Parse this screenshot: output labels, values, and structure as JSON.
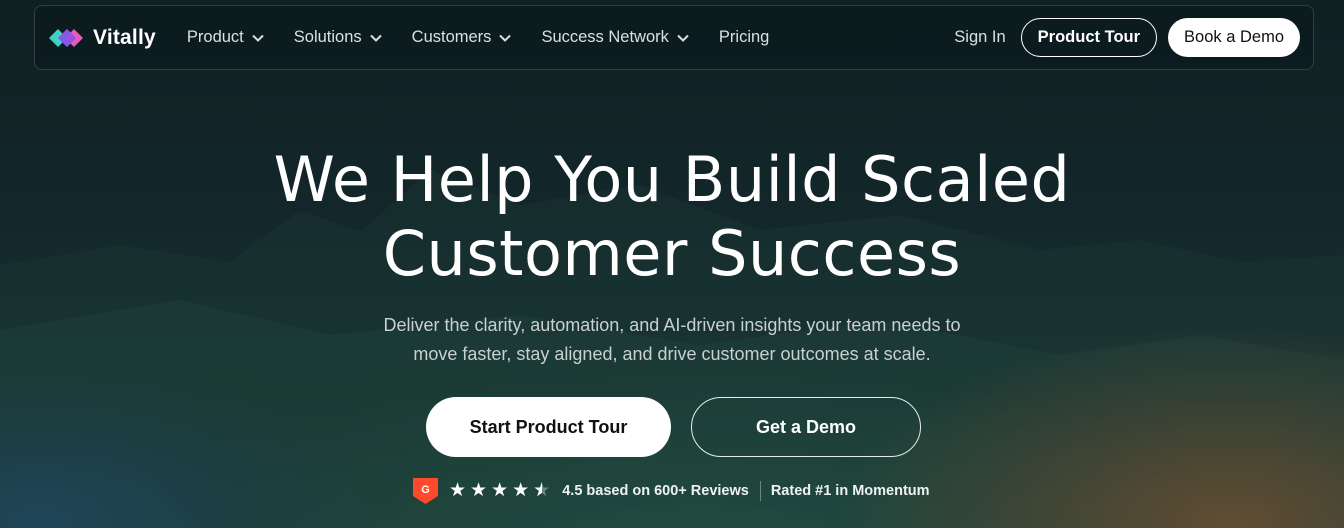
{
  "brand": {
    "name": "Vitally"
  },
  "nav": {
    "items": [
      {
        "label": "Product",
        "has_dropdown": true
      },
      {
        "label": "Solutions",
        "has_dropdown": true
      },
      {
        "label": "Customers",
        "has_dropdown": true
      },
      {
        "label": "Success Network",
        "has_dropdown": true
      },
      {
        "label": "Pricing",
        "has_dropdown": false
      }
    ],
    "sign_in": "Sign In",
    "product_tour": "Product Tour",
    "book_demo": "Book a Demo"
  },
  "hero": {
    "title_line1": "We Help You Build Scaled",
    "title_line2": "Customer Success",
    "subtitle_line1": "Deliver the clarity, automation, and AI-driven insights your team needs to",
    "subtitle_line2": "move faster, stay aligned, and drive customer outcomes at scale.",
    "cta_primary": "Start Product Tour",
    "cta_secondary": "Get a Demo"
  },
  "rating": {
    "badge_icon": "g2-logo-icon",
    "stars": 4.5,
    "stars_max": 5,
    "text": "4.5 based on 600+ Reviews",
    "award": "Rated #1 in Momentum"
  },
  "colors": {
    "background": "#13272a",
    "g2_red": "#ff492c",
    "button_white": "#ffffff"
  }
}
